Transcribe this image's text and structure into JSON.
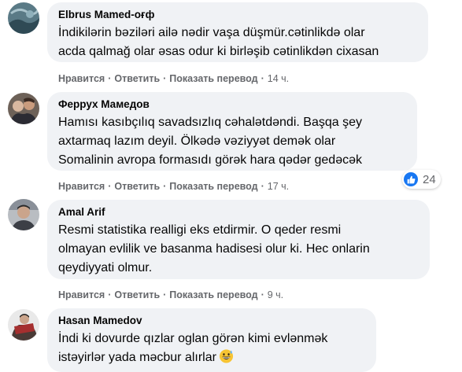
{
  "comments": [
    {
      "author": "Elbrus Mamed-оғф",
      "lines": [
        "İndikilərin bəziləri ailə nədir vaşa düşmür.cətinlikdə olar",
        "acda qalmağ olar əsas odur ki birləşib cətinlikdən cixasan"
      ],
      "like_label": "Нравится",
      "reply_label": "Ответить",
      "translate_label": "Показать перевод",
      "time": "14 ч."
    },
    {
      "author": "Феррух Мамедов",
      "lines": [
        "Hamısı kasıbçılıq savadsızlıq cəhalətdəndi. Başqa şey",
        "axtarmaq lazım deyil. Ölkədə vəziyyət demək olar",
        "Somalinin avropa formasıdı görək hara qədər gedəcək"
      ],
      "like_label": "Нравится",
      "reply_label": "Ответить",
      "translate_label": "Показать перевод",
      "time": "17 ч.",
      "reaction_count": "24"
    },
    {
      "author": "Amal Arif",
      "lines": [
        "Resmi statistika realligi eks etdirmir. O qeder resmi",
        "olmayan evlilik ve basanma hadisesi olur ki. Hec onlarin",
        "qeydiyyati olmur."
      ],
      "like_label": "Нравится",
      "reply_label": "Ответить",
      "translate_label": "Показать перевод",
      "time": "9 ч."
    },
    {
      "author": "Hasan Mamedov",
      "lines": [
        "İndi ki dovurde qızlar oglan görən kimi evlənmək",
        "istəyirlər yada məcbur alırlar"
      ]
    }
  ],
  "icons": {
    "like": "thumbs-up-icon",
    "emoji": "grinning-sweat-emoji"
  },
  "colors": {
    "bubble": "#f0f2f5",
    "meta_text": "#65676b",
    "like_blue": "#1877f2"
  }
}
